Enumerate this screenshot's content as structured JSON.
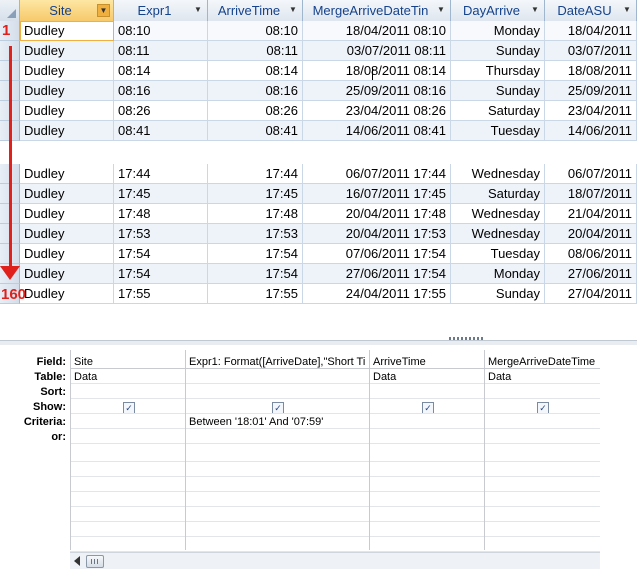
{
  "datasheet": {
    "columns": [
      {
        "name": "col-site",
        "label": "Site",
        "width": 94
      },
      {
        "name": "col-expr1",
        "label": "Expr1",
        "width": 94
      },
      {
        "name": "col-arrivetime",
        "label": "ArriveTime",
        "width": 95
      },
      {
        "name": "col-mergearrivedatetime",
        "label": "MergeArriveDateTin",
        "width": 148
      },
      {
        "name": "col-dayarrive",
        "label": "DayArrive",
        "width": 94
      },
      {
        "name": "col-dateasu",
        "label": "DateASU",
        "width": 92
      }
    ],
    "rows_top": [
      [
        "Dudley",
        "08:10",
        "08:10",
        "18/04/2011 08:10",
        "Monday",
        "18/04/2011"
      ],
      [
        "Dudley",
        "08:11",
        "08:11",
        "03/07/2011 08:11",
        "Sunday",
        "03/07/2011"
      ],
      [
        "Dudley",
        "08:14",
        "08:14",
        "18/08/2011 08:14",
        "Thursday",
        "18/08/2011"
      ],
      [
        "Dudley",
        "08:16",
        "08:16",
        "25/09/2011 08:16",
        "Sunday",
        "25/09/2011"
      ],
      [
        "Dudley",
        "08:26",
        "08:26",
        "23/04/2011 08:26",
        "Saturday",
        "23/04/2011"
      ],
      [
        "Dudley",
        "08:41",
        "08:41",
        "14/06/2011 08:41",
        "Tuesday",
        "14/06/2011"
      ]
    ],
    "rows_bottom": [
      [
        "Dudley",
        "17:44",
        "17:44",
        "06/07/2011 17:44",
        "Wednesday",
        "06/07/2011"
      ],
      [
        "Dudley",
        "17:45",
        "17:45",
        "16/07/2011 17:45",
        "Saturday",
        "18/07/2011"
      ],
      [
        "Dudley",
        "17:48",
        "17:48",
        "20/04/2011 17:48",
        "Wednesday",
        "21/04/2011"
      ],
      [
        "Dudley",
        "17:53",
        "17:53",
        "20/04/2011 17:53",
        "Wednesday",
        "20/04/2011"
      ],
      [
        "Dudley",
        "17:54",
        "17:54",
        "07/06/2011 17:54",
        "Tuesday",
        "08/06/2011"
      ],
      [
        "Dudley",
        "17:54",
        "17:54",
        "27/06/2011 17:54",
        "Monday",
        "27/06/2011"
      ],
      [
        "Dudley",
        "17:55",
        "17:55",
        "24/04/2011 17:55",
        "Sunday",
        "27/04/2011"
      ]
    ],
    "annotation": {
      "start": "1",
      "end": "160"
    }
  },
  "qbe": {
    "row_labels": [
      "Field:",
      "Table:",
      "Sort:",
      "Show:",
      "Criteria:",
      "or:"
    ],
    "columns": [
      {
        "field": "Site",
        "table": "Data",
        "show": true,
        "criteria": ""
      },
      {
        "field": "Expr1: Format([ArriveDate],\"Short Ti",
        "table": "",
        "show": true,
        "criteria": "Between '18:01' And '07:59'"
      },
      {
        "field": "ArriveTime",
        "table": "Data",
        "show": true,
        "criteria": ""
      },
      {
        "field": "MergeArriveDateTime",
        "table": "Data",
        "show": true,
        "criteria": ""
      }
    ]
  },
  "colors": {
    "annotation": "#e0201a",
    "header_text": "#15428b",
    "selected_header": "#f7c96a"
  }
}
